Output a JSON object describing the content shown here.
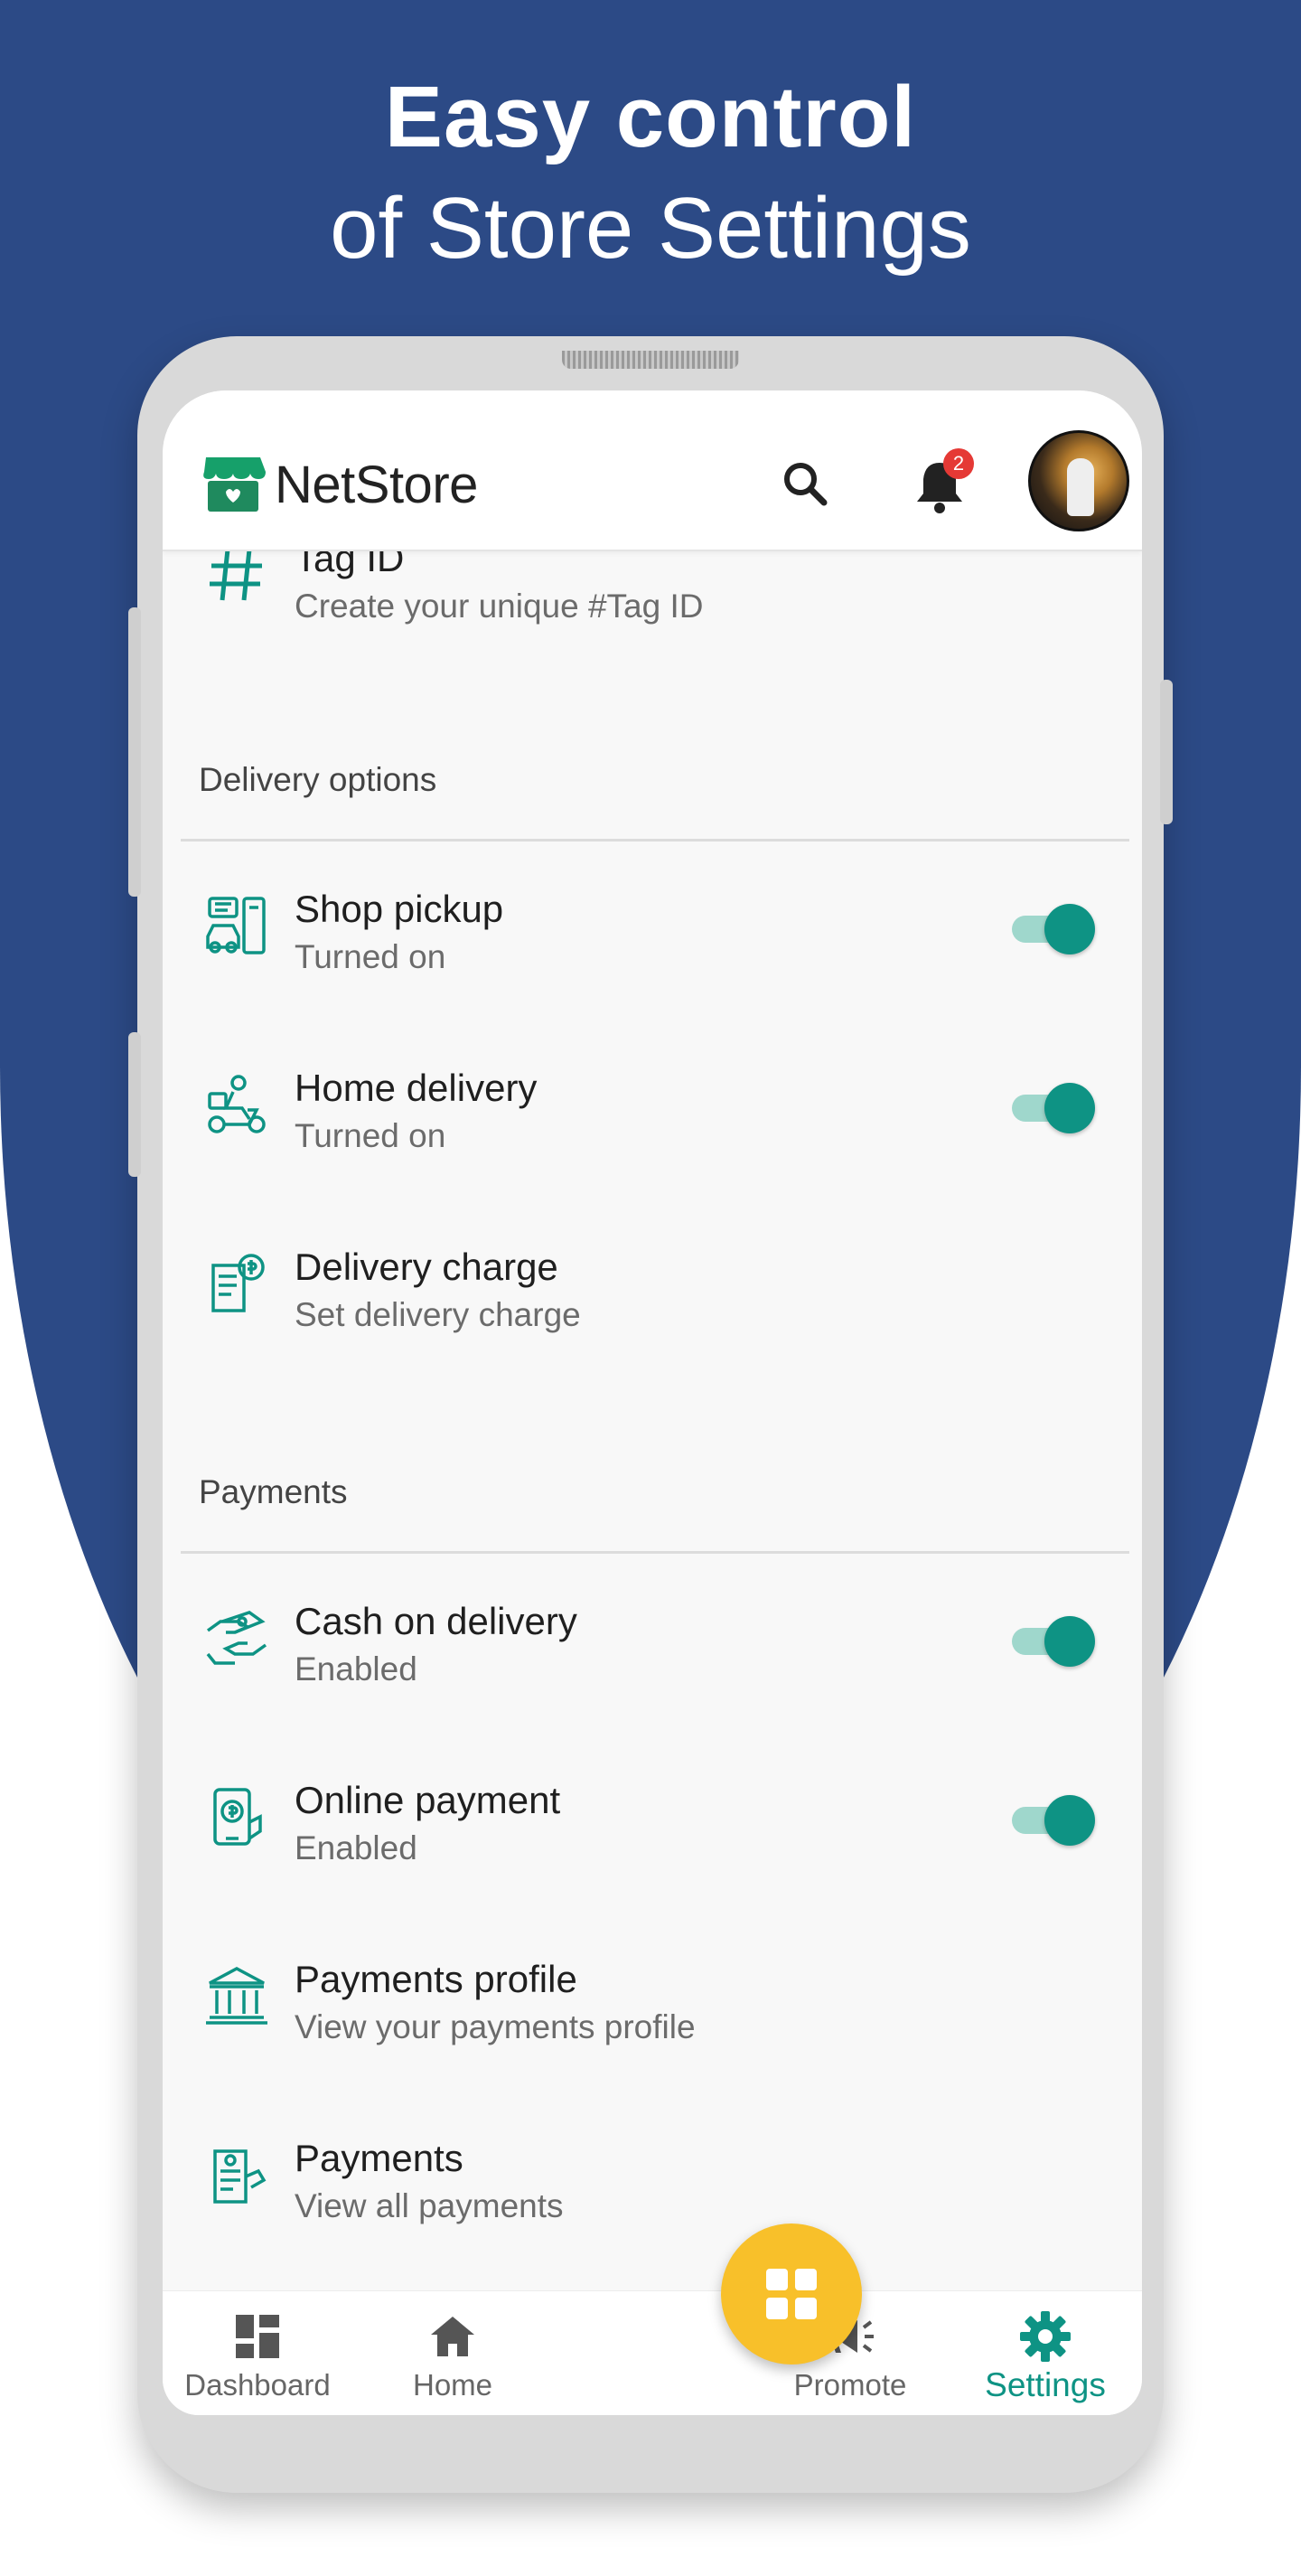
{
  "headline": {
    "line1": "Easy control",
    "line2": "of Store Settings"
  },
  "appbar": {
    "title": "NetStore",
    "notification_count": "2"
  },
  "partial_row": {
    "title": "Tag ID",
    "subtitle": "Create your unique #Tag ID",
    "icon": "hashtag-icon"
  },
  "delivery": {
    "header": "Delivery options",
    "items": [
      {
        "title": "Shop pickup",
        "subtitle": "Turned on",
        "icon": "shop-pickup-icon",
        "toggle": true
      },
      {
        "title": "Home delivery",
        "subtitle": "Turned on",
        "icon": "delivery-scooter-icon",
        "toggle": true
      },
      {
        "title": "Delivery charge",
        "subtitle": "Set delivery charge",
        "icon": "delivery-charge-icon",
        "toggle": false
      }
    ]
  },
  "payments": {
    "header": "Payments",
    "items": [
      {
        "title": "Cash on delivery",
        "subtitle": "Enabled",
        "icon": "cash-hand-icon",
        "toggle": true
      },
      {
        "title": "Online payment",
        "subtitle": "Enabled",
        "icon": "online-payment-icon",
        "toggle": true
      },
      {
        "title": "Payments profile",
        "subtitle": "View your payments profile",
        "icon": "bank-icon",
        "toggle": false
      },
      {
        "title": "Payments",
        "subtitle": "View all payments",
        "icon": "invoice-icon",
        "toggle": false
      }
    ]
  },
  "bottomnav": {
    "items": [
      {
        "label": "Dashboard",
        "icon": "dashboard-icon"
      },
      {
        "label": "Home",
        "icon": "home-icon"
      },
      {
        "label": "Promote",
        "icon": "megaphone-icon"
      },
      {
        "label": "Settings",
        "icon": "gear-icon",
        "active": true
      }
    ],
    "fab_icon": "apps-grid-icon"
  },
  "colors": {
    "brand_blue": "#2c4a86",
    "teal": "#0e9384",
    "fab_yellow": "#f8c02a",
    "badge_red": "#e53935"
  }
}
